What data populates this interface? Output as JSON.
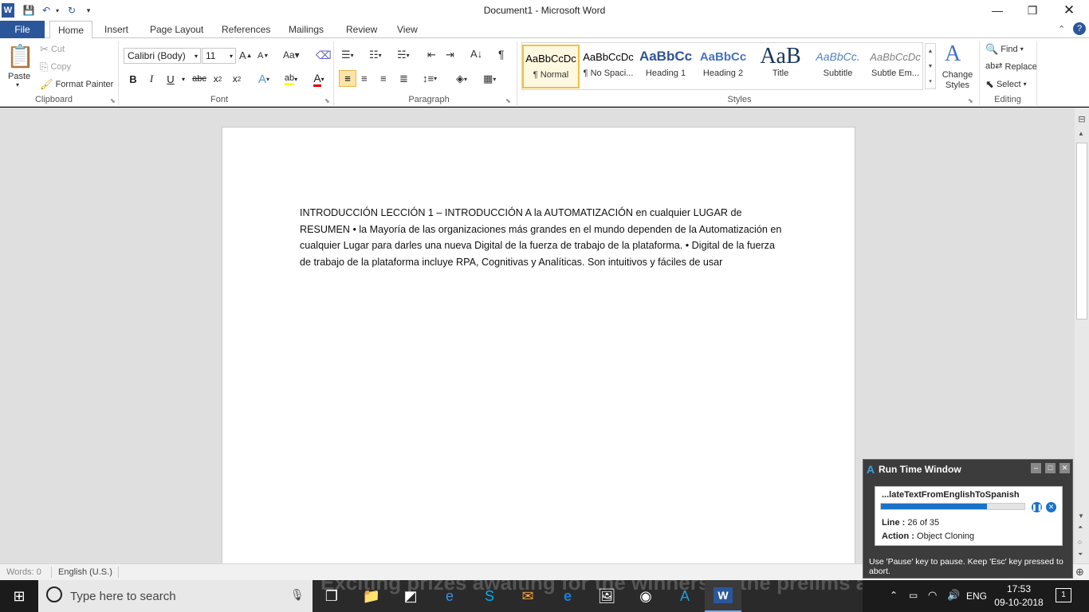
{
  "window": {
    "title": "Document1  -  Microsoft Word"
  },
  "quick_access": {
    "icons": [
      "word-icon",
      "save-icon",
      "undo-icon",
      "redo-icon",
      "customize-icon"
    ]
  },
  "tabs": [
    "File",
    "Home",
    "Insert",
    "Page Layout",
    "References",
    "Mailings",
    "Review",
    "View"
  ],
  "active_tab": "Home",
  "clipboard": {
    "paste": "Paste",
    "cut": "Cut",
    "copy": "Copy",
    "format_painter": "Format Painter",
    "label": "Clipboard"
  },
  "font": {
    "family": "Calibri (Body)",
    "size": "11",
    "label": "Font"
  },
  "paragraph": {
    "label": "Paragraph"
  },
  "styles": {
    "label": "Styles",
    "items": [
      {
        "sample": "AaBbCcDc",
        "name": "¶ Normal"
      },
      {
        "sample": "AaBbCcDc",
        "name": "¶ No Spaci..."
      },
      {
        "sample": "AaBbCc",
        "name": "Heading 1"
      },
      {
        "sample": "AaBbCc",
        "name": "Heading 2"
      },
      {
        "sample": "AaB",
        "name": "Title"
      },
      {
        "sample": "AaBbCc.",
        "name": "Subtitle"
      },
      {
        "sample": "AaBbCcDc",
        "name": "Subtle Em..."
      }
    ],
    "change_styles": "Change Styles"
  },
  "editing": {
    "find": "Find",
    "replace": "Replace",
    "select": "Select",
    "label": "Editing"
  },
  "document": {
    "text": " INTRODUCCIÓN LECCIÓN 1 – INTRODUCCIÓN A la AUTOMATIZACIÓN en cualquier LUGAR de RESUMEN • la Mayoría de las organizaciones más grandes en el mundo dependen de la Automatización en cualquier Lugar para darles una nueva Digital de la fuerza de trabajo de la plataforma. • Digital de la fuerza de trabajo de la plataforma incluye RPA, Cognitivas y Analíticas. Son intuitivos y fáciles de usar"
  },
  "status": {
    "words": "Words: 0",
    "language": "English (U.S.)"
  },
  "runtime_window": {
    "title": "Run Time Window",
    "task": "...lateTextFromEnglishToSpanish",
    "progress": 0.74,
    "line_label": "Line :",
    "line_value": "26 of 35",
    "action_label": "Action :",
    "action_value": "Object Cloning",
    "hint": "Use 'Pause' key to pause. Keep 'Esc' key pressed to abort."
  },
  "taskbar": {
    "search_placeholder": "Type here to search",
    "background_text": "Exciting prizes awaiting for the winners in the prelims and the finals",
    "language": "ENG",
    "time": "17:53",
    "date": "09-10-2018",
    "notifications": "1"
  }
}
